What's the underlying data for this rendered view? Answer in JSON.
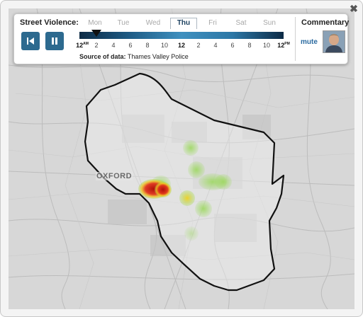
{
  "panel": {
    "title": "Street Violence:",
    "days": [
      "Mon",
      "Tue",
      "Wed",
      "Thu",
      "Fri",
      "Sat",
      "Sun"
    ],
    "active_day": "Thu",
    "hours": [
      "12",
      "2",
      "4",
      "6",
      "8",
      "10",
      "12",
      "2",
      "4",
      "6",
      "8",
      "10",
      "12"
    ],
    "am_label": "AM",
    "pm_label": "PM",
    "source_label": "Source of data:",
    "source_value": "Thames Valley Police",
    "controls": {
      "rewind_icon": "skip-back-icon",
      "pause_icon": "pause-icon"
    }
  },
  "commentary": {
    "title": "Commentary",
    "mute_label": "mute",
    "avatar_icon": "commentator-avatar"
  },
  "map": {
    "place_label": "OXFORD",
    "hotspot_colors": {
      "low": "#8fd14f",
      "mid": "#f2d21f",
      "high": "#c9160f"
    }
  },
  "window": {
    "close_icon": "close-icon"
  }
}
